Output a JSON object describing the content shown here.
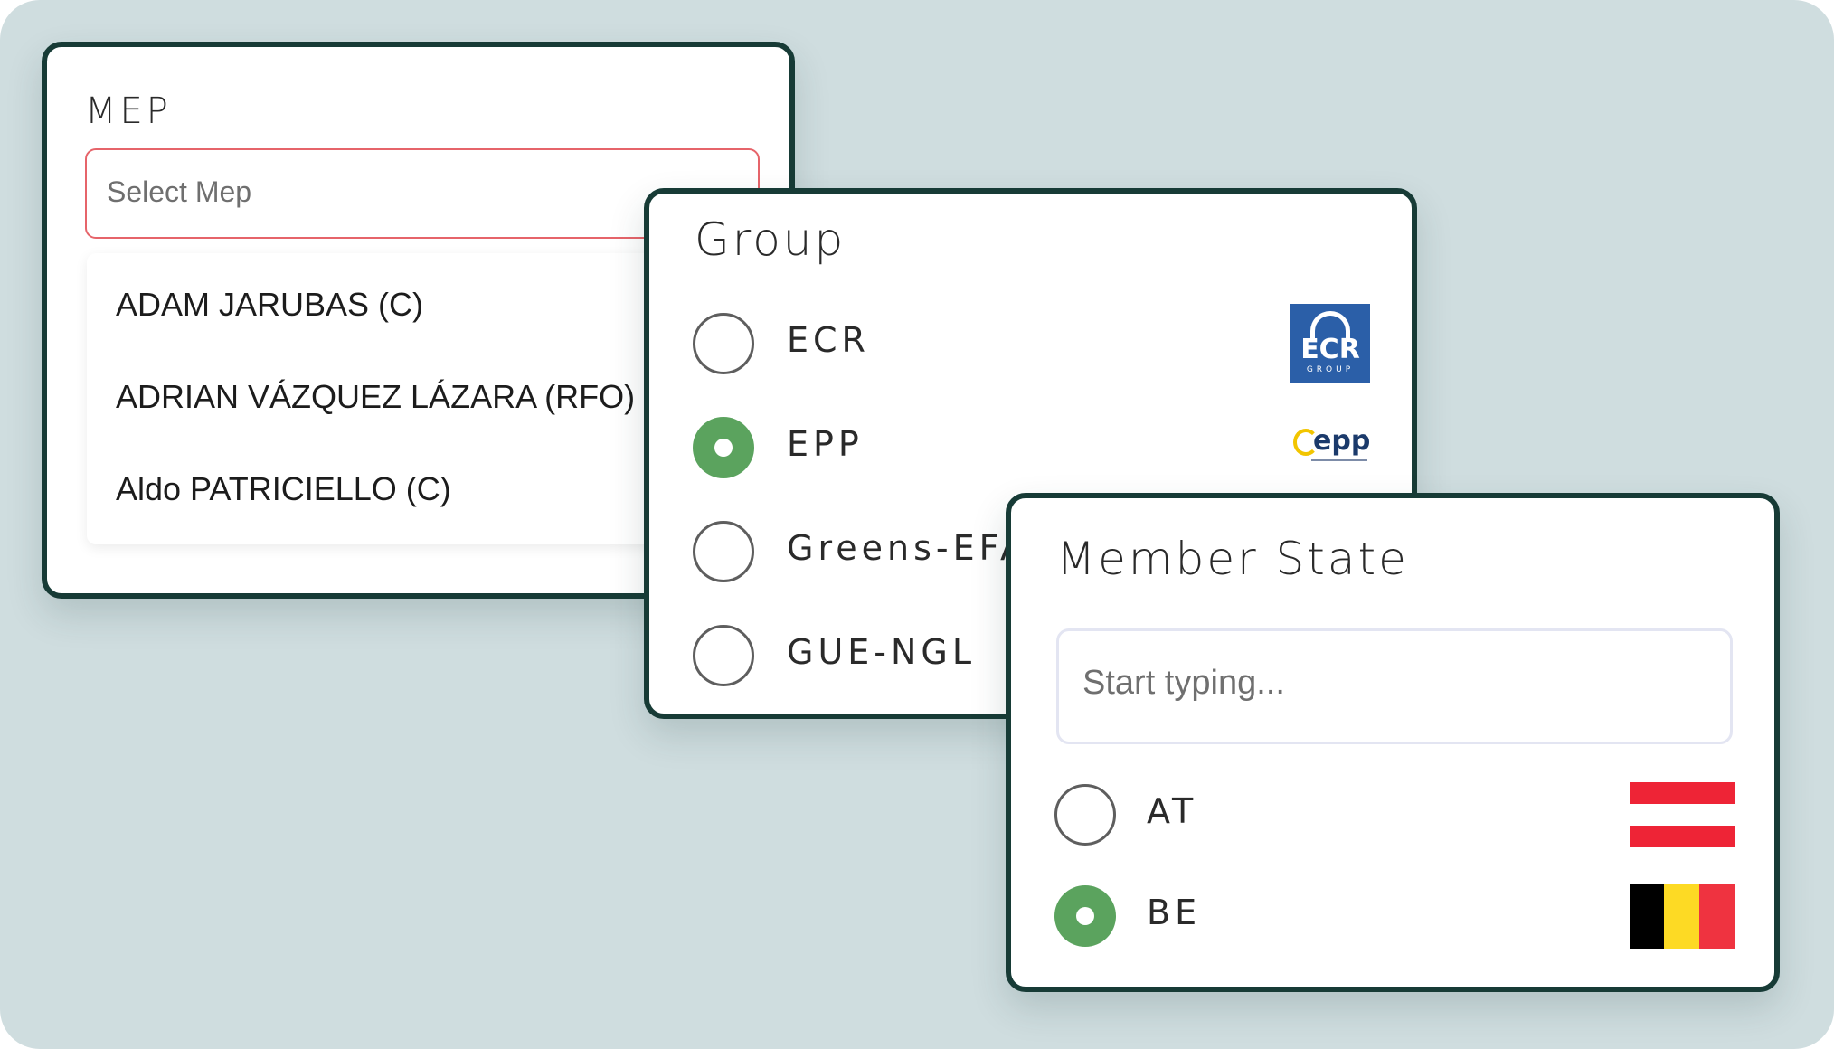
{
  "mep": {
    "title": "MEP",
    "select_placeholder": "Select Mep",
    "options": [
      "ADAM JARUBAS (C)",
      "ADRIAN VÁZQUEZ LÁZARA (RFO)",
      "Aldo PATRICIELLO (C)"
    ]
  },
  "group": {
    "title": "Group",
    "options": [
      {
        "label": "ECR",
        "checked": false,
        "logo": "ecr-group-logo",
        "logo_text": "ECR",
        "logo_subtext": "GROUP"
      },
      {
        "label": "EPP",
        "checked": true,
        "logo": "epp-logo",
        "logo_text": "epp"
      },
      {
        "label": "Greens-EFA",
        "checked": false
      },
      {
        "label": "GUE-NGL",
        "checked": false
      }
    ]
  },
  "member_state": {
    "title": "Member State",
    "input_placeholder": "Start typing...",
    "options": [
      {
        "label": "AT",
        "checked": false,
        "flag": "austria-flag-icon"
      },
      {
        "label": "BE",
        "checked": true,
        "flag": "belgium-flag-icon"
      }
    ]
  },
  "colors": {
    "background": "#cfdddf",
    "card_border": "#173b36",
    "radio_checked": "#5ba35e",
    "select_border": "#e6646a"
  }
}
